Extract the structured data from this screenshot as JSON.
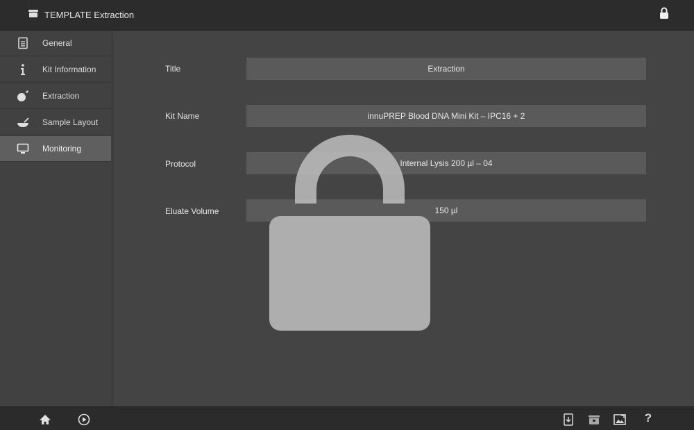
{
  "window": {
    "title": "TEMPLATE Extraction",
    "title_icon": "template-icon",
    "lock_icon": "lock-icon"
  },
  "sidebar": {
    "items": [
      {
        "label": "General",
        "icon": "document-icon",
        "active": false
      },
      {
        "label": "Kit Information",
        "icon": "info-icon",
        "active": false
      },
      {
        "label": "Extraction",
        "icon": "extraction-icon",
        "active": false
      },
      {
        "label": "Sample Layout",
        "icon": "sample-tray-icon",
        "active": false
      },
      {
        "label": "Monitoring",
        "icon": "monitor-icon",
        "active": true
      }
    ]
  },
  "form": {
    "title_label": "Title",
    "title_value": "Extraction",
    "kit_name_label": "Kit Name",
    "kit_name_value": "innuPREP Blood DNA Mini Kit – IPC16 + 2",
    "protocol_label": "Protocol",
    "protocol_value": "Internal Lysis 200 µl – 04",
    "eluate_volume_label": "Eluate Volume",
    "eluate_volume_value": "150 µl"
  },
  "overlay": {
    "icon": "large-lock-icon",
    "locked": true
  },
  "bottombar": {
    "left": [
      "home-icon",
      "play-circle-icon"
    ],
    "right": [
      "export-icon",
      "template-box-icon",
      "image-icon",
      "help-icon"
    ],
    "help_label": "?"
  },
  "colors": {
    "background": "#434343",
    "topbar": "#2c2c2c",
    "field": "#5a5a5a",
    "active_item": "#5f5f5f",
    "lock_overlay": "#b4b4b4"
  }
}
